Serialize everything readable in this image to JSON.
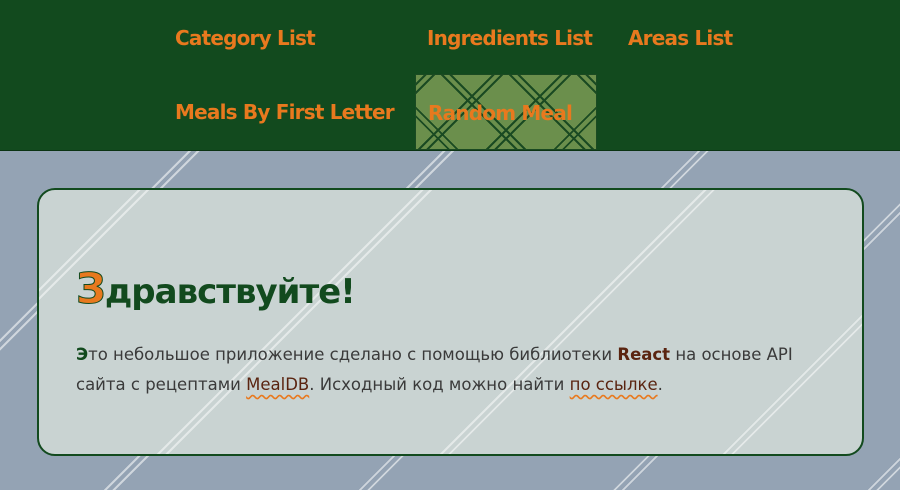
{
  "nav": {
    "items": [
      {
        "label": "Category List"
      },
      {
        "label": "Ingredients List"
      },
      {
        "label": "Areas List"
      },
      {
        "label": "Meals By First Letter"
      },
      {
        "label": "Random Meal"
      }
    ],
    "active_item": "Random Meal"
  },
  "welcome": {
    "heading_first": "З",
    "heading_rest": "дравствуйте!",
    "text_first": "Э",
    "text_part1": "то небольшое приложение сделано с помощью библиотеки ",
    "react": "React",
    "text_part2": " на основе API сайта с рецептами ",
    "mealdb": "MealDB",
    "text_part3": ". Исходный код можно найти ",
    "source_link": "по ссылке",
    "text_end": "."
  },
  "colors": {
    "nav_background": "#124a1e",
    "accent": "#e8791e",
    "page_background": "#94a3b4",
    "card_background": "#c9d3d2",
    "link": "#5a2410"
  }
}
